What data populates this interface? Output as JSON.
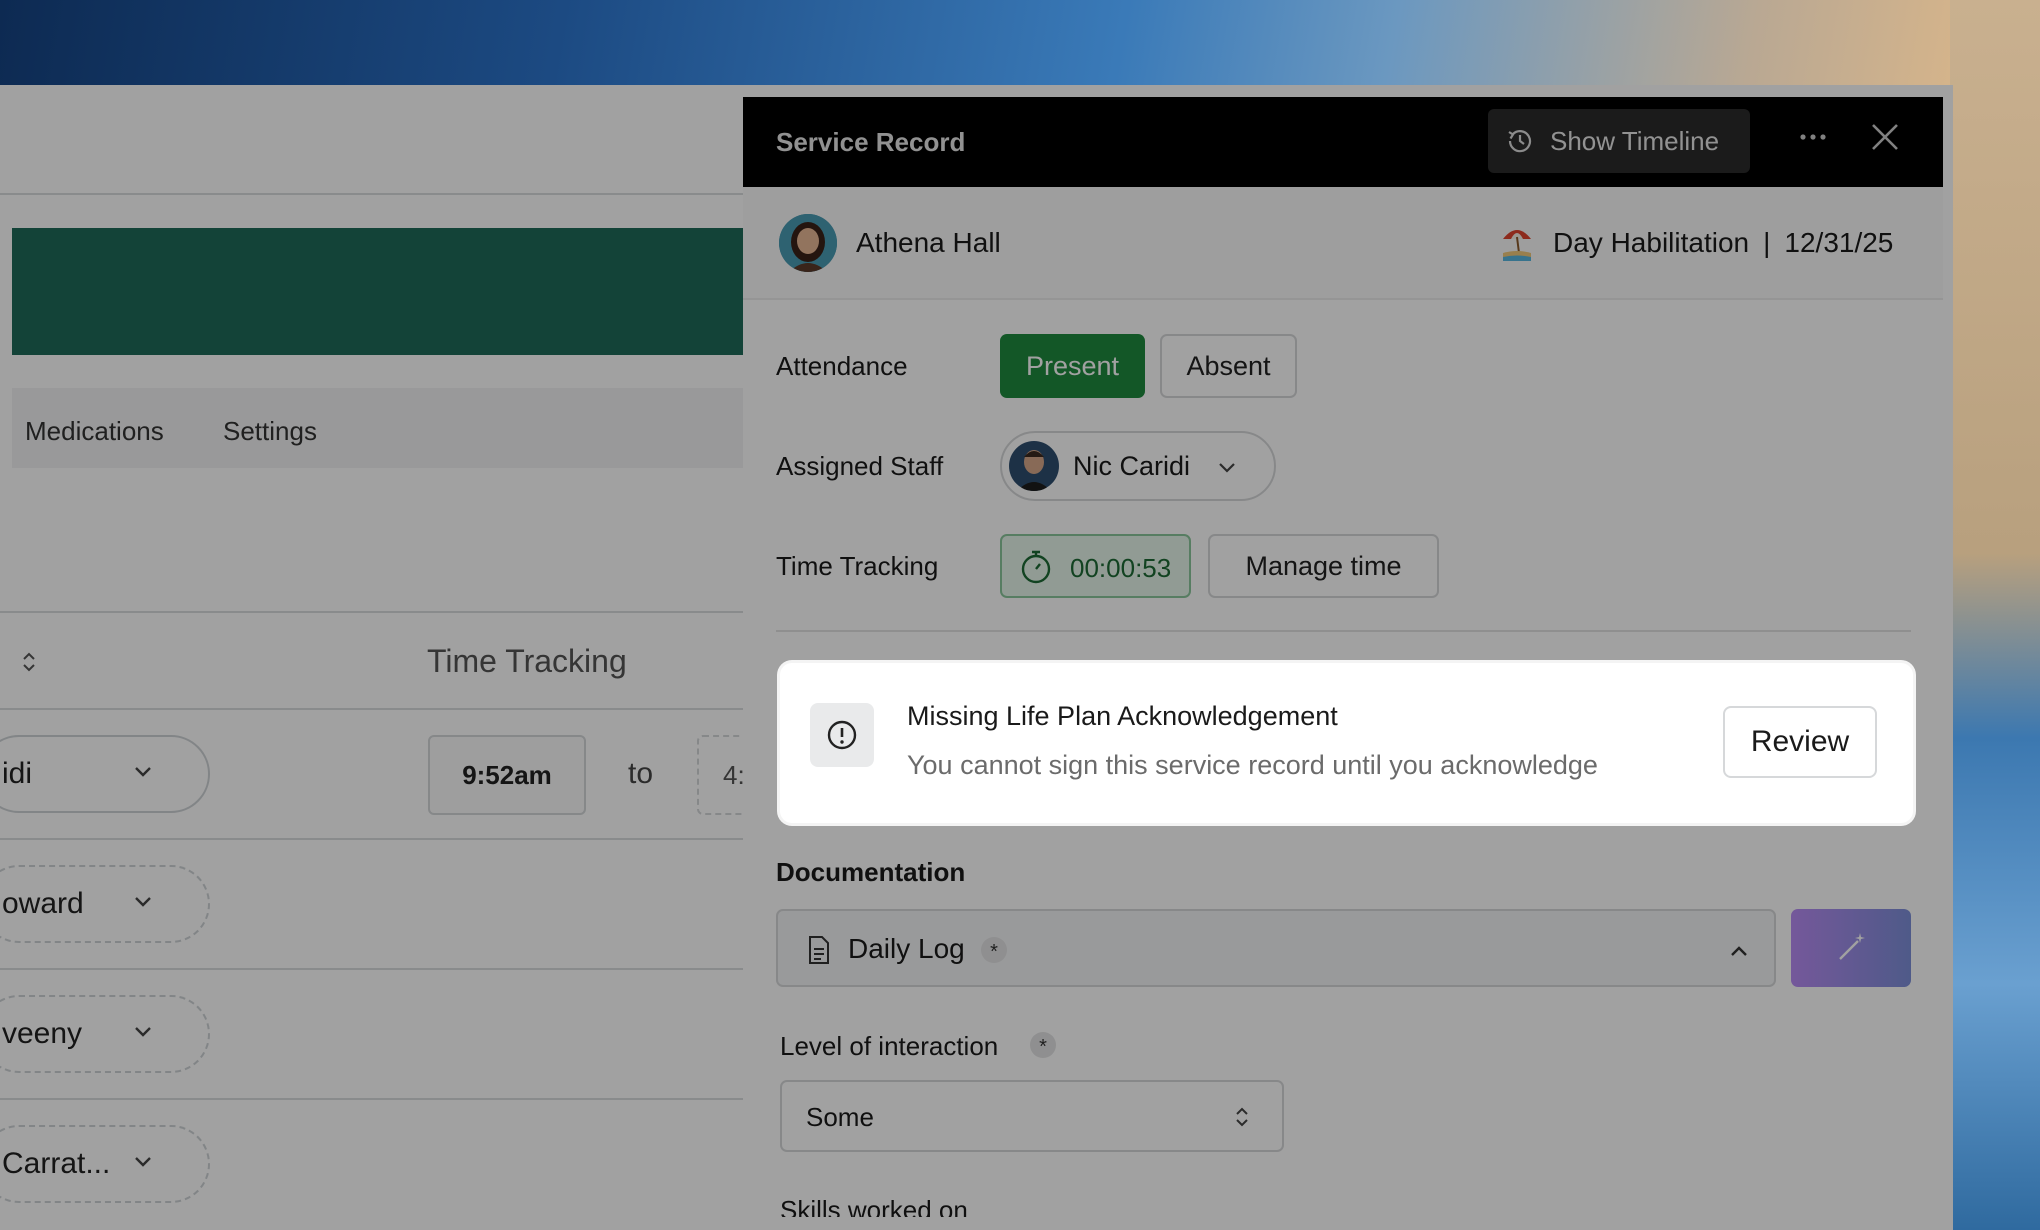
{
  "background_app": {
    "tabs": [
      "Medications",
      "Settings"
    ],
    "column_header": "Time Tracking",
    "rows": [
      {
        "staff": "idi"
      },
      {
        "staff": "oward"
      },
      {
        "staff": "veeny"
      },
      {
        "staff": "Carrat..."
      }
    ],
    "start_time": "9:52am",
    "to_label": "to",
    "end_time_partial": "4:"
  },
  "panel": {
    "title": "Service Record",
    "timeline_button": "Show Timeline",
    "client_name": "Athena Hall",
    "service_name": "Day Habilitation",
    "separator": "|",
    "service_date": "12/31/25",
    "attendance_label": "Attendance",
    "present_label": "Present",
    "absent_label": "Absent",
    "assigned_staff_label": "Assigned Staff",
    "assigned_staff_name": "Nic Caridi",
    "time_tracking_label": "Time Tracking",
    "timer_value": "00:00:53",
    "manage_time_label": "Manage time",
    "documentation_label": "Documentation",
    "document_name": "Daily Log",
    "required_mark": "*",
    "level_of_interaction_label": "Level of interaction",
    "level_of_interaction_value": "Some",
    "skills_label": "Skills worked on"
  },
  "alert": {
    "title": "Missing Life Plan Acknowledgement",
    "message": "You cannot sign this service record until you acknowledge",
    "action_label": "Review"
  },
  "colors": {
    "present_green": "#1f8a3e",
    "header_black": "#000000",
    "banner_teal": "#1f6b5a",
    "magic_gradient": "#b98cf5"
  }
}
